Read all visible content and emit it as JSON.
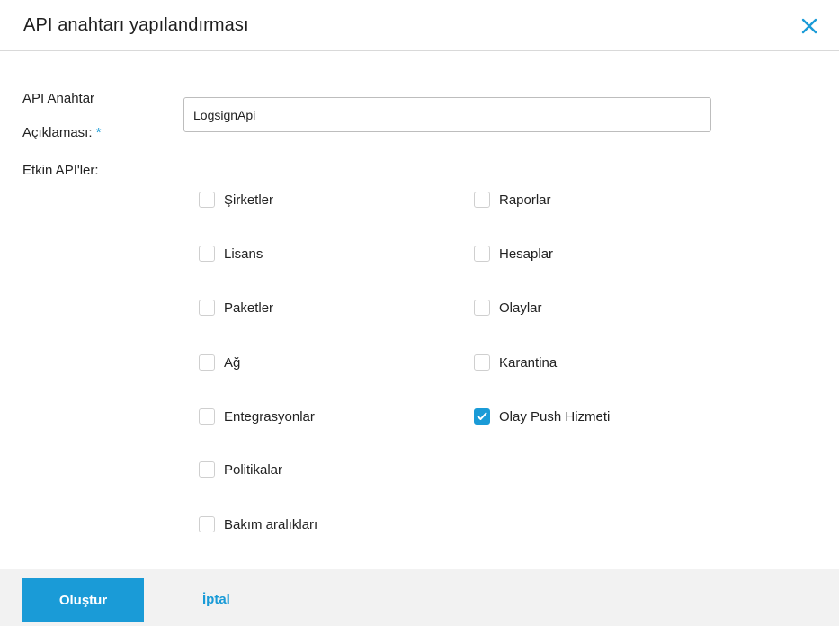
{
  "dialog": {
    "title": "API anahtarı yapılandırması",
    "close_icon": "close-icon"
  },
  "form": {
    "description_label_line1": "API Anahtar",
    "description_label_line2": "Açıklaması:",
    "required_marker": "*",
    "description_value": "LogsignApi",
    "enabled_apis_label": "Etkin API'ler:"
  },
  "apis_left": [
    {
      "label": "Şirketler",
      "checked": false
    },
    {
      "label": "Lisans",
      "checked": false
    },
    {
      "label": "Paketler",
      "checked": false
    },
    {
      "label": "Ağ",
      "checked": false
    },
    {
      "label": "Entegrasyonlar",
      "checked": false
    },
    {
      "label": "Politikalar",
      "checked": false
    },
    {
      "label": "Bakım aralıkları",
      "checked": false
    }
  ],
  "apis_right": [
    {
      "label": "Raporlar",
      "checked": false
    },
    {
      "label": "Hesaplar",
      "checked": false
    },
    {
      "label": "Olaylar",
      "checked": false
    },
    {
      "label": "Karantina",
      "checked": false
    },
    {
      "label": "Olay Push Hizmeti",
      "checked": true
    }
  ],
  "footer": {
    "create_label": "Oluştur",
    "cancel_label": "İptal"
  },
  "colors": {
    "accent": "#1a9bd7",
    "footer_bg": "#f2f2f2",
    "border": "#d9d9d9"
  }
}
